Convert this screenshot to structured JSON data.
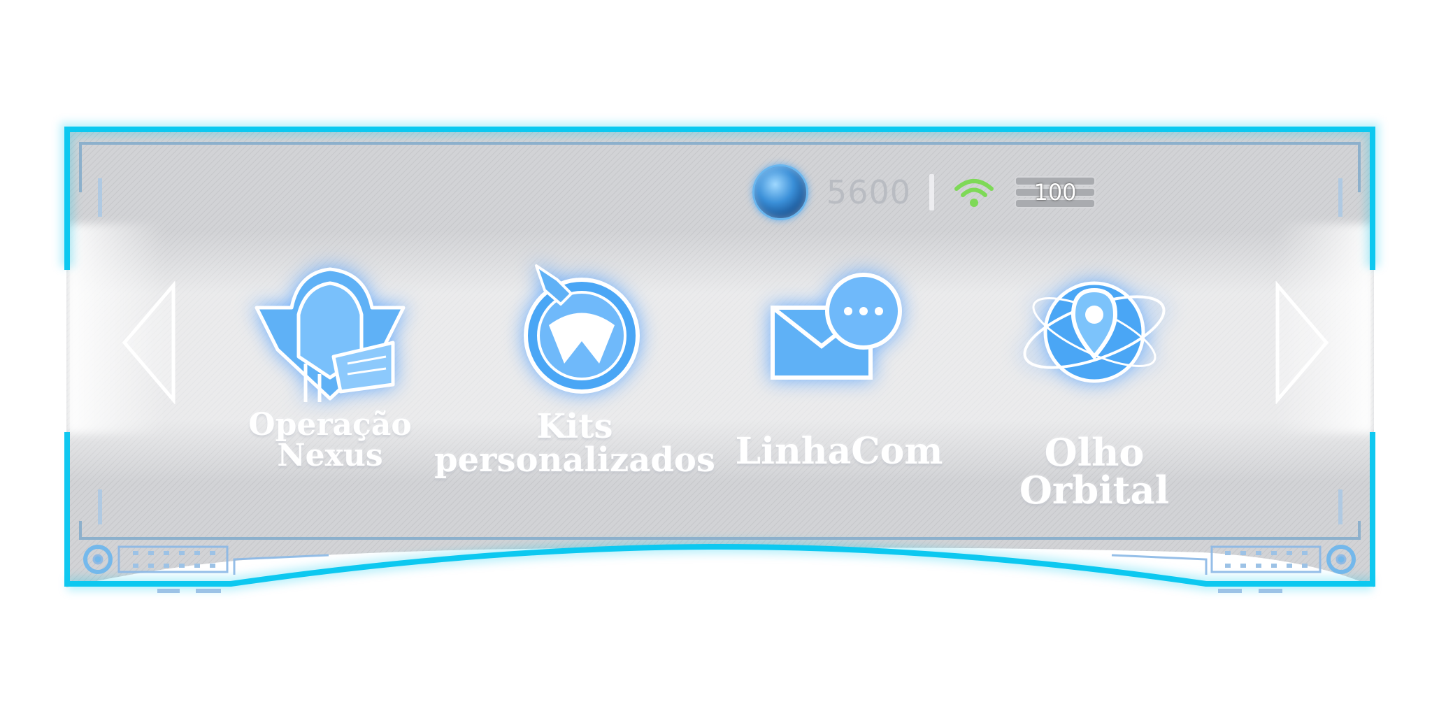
{
  "hud": {
    "currency_icon": "blue-orb-gem-icon",
    "currency_amount": "5600",
    "signal_icon": "wifi-icon",
    "signal_color": "#7ed957",
    "battery_level": "100"
  },
  "navigation": {
    "prev_icon": "chevron-left-icon",
    "next_icon": "chevron-right-icon"
  },
  "menu": {
    "items": [
      {
        "label_line1": "Operação",
        "label_line2": "Nexus",
        "icon": "hooded-operative-icon"
      },
      {
        "label_line1": "Kits",
        "label_line2": "personalizados",
        "icon": "rocket-logo-icon"
      },
      {
        "label_line1": "LinhaCom",
        "label_line2": "",
        "icon": "mail-chat-icon"
      },
      {
        "label_line1": "Olho Orbital",
        "label_line2": "",
        "icon": "orbital-location-icon"
      }
    ]
  },
  "colors": {
    "frame_accent": "#10c8f0",
    "panel_fill": "#d4d5d8",
    "icon_glow": "#4aa6f5"
  }
}
